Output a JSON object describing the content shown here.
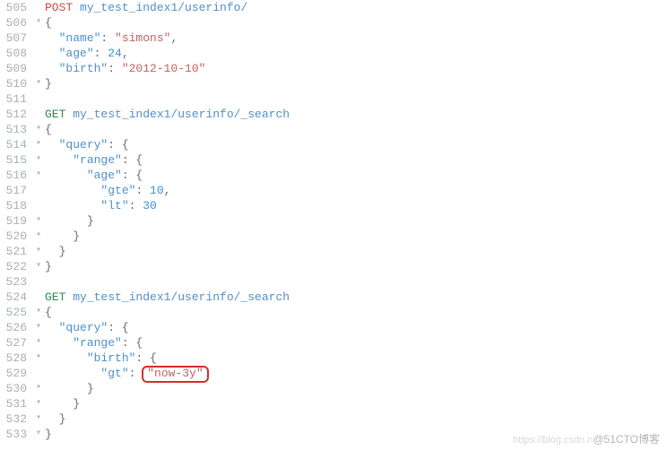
{
  "line_start": 505,
  "fold_lines": [
    506,
    510,
    513,
    514,
    515,
    516,
    519,
    520,
    521,
    522,
    525,
    526,
    527,
    528,
    530,
    531,
    532,
    533
  ],
  "code": {
    "l505": {
      "method": "POST",
      "path": "my_test_index1/userinfo/"
    },
    "l506": "{",
    "l507": {
      "indent": "  ",
      "key": "\"name\"",
      "sep": ": ",
      "val": "\"simons\"",
      "tail": ","
    },
    "l508": {
      "indent": "  ",
      "key": "\"age\"",
      "sep": ": ",
      "num": "24",
      "tail": ","
    },
    "l509": {
      "indent": "  ",
      "key": "\"birth\"",
      "sep": ": ",
      "val": "\"2012-10-10\""
    },
    "l510": "}",
    "l511": "",
    "l512": {
      "method": "GET",
      "path": "my_test_index1/userinfo/_search"
    },
    "l513": "{",
    "l514": {
      "indent": "  ",
      "key": "\"query\"",
      "sep": ": {",
      "tail": ""
    },
    "l515": {
      "indent": "    ",
      "key": "\"range\"",
      "sep": ": {",
      "tail": ""
    },
    "l516": {
      "indent": "      ",
      "key": "\"age\"",
      "sep": ": {",
      "tail": ""
    },
    "l517": {
      "indent": "        ",
      "key": "\"gte\"",
      "sep": ": ",
      "num": "10",
      "tail": ","
    },
    "l518": {
      "indent": "        ",
      "key": "\"lt\"",
      "sep": ": ",
      "num": "30"
    },
    "l519": {
      "indent": "      ",
      "close": "}"
    },
    "l520": {
      "indent": "    ",
      "close": "}"
    },
    "l521": {
      "indent": "  ",
      "close": "}"
    },
    "l522": "}",
    "l523": "",
    "l524": {
      "method": "GET",
      "path": "my_test_index1/userinfo/_search"
    },
    "l525": "{",
    "l526": {
      "indent": "  ",
      "key": "\"query\"",
      "sep": ": {",
      "tail": ""
    },
    "l527": {
      "indent": "    ",
      "key": "\"range\"",
      "sep": ": {",
      "tail": ""
    },
    "l528": {
      "indent": "      ",
      "key": "\"birth\"",
      "sep": ": {",
      "tail": ""
    },
    "l529": {
      "indent": "        ",
      "key": "\"gt\"",
      "sep": ": ",
      "highlight_val": "\"now-3y\""
    },
    "l530": {
      "indent": "      ",
      "close": "}"
    },
    "l531": {
      "indent": "    ",
      "close": "}"
    },
    "l532": {
      "indent": "  ",
      "close": "}"
    },
    "l533": "}"
  },
  "watermark": {
    "pre": "https://blog.csdn.n",
    "main": "@51CTO博客"
  }
}
